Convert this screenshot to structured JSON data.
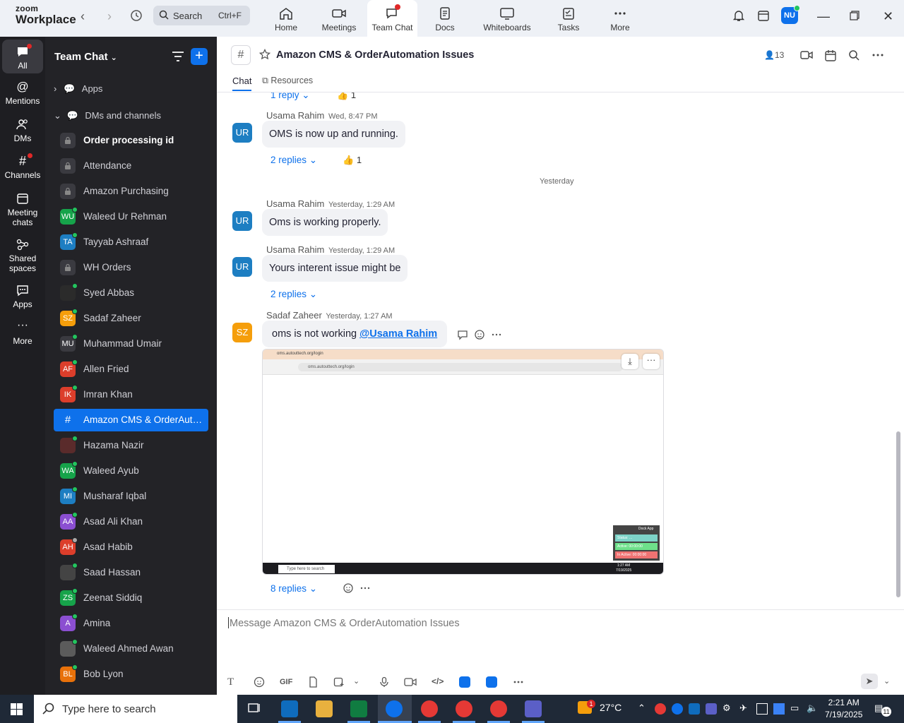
{
  "app": {
    "logo_line1": "zoom",
    "logo_line2": "Workplace",
    "search_label": "Search",
    "search_shortcut": "Ctrl+F",
    "user_initials": "NU"
  },
  "nav_tabs": [
    {
      "label": "Home",
      "icon": "home-icon"
    },
    {
      "label": "Meetings",
      "icon": "camera-icon"
    },
    {
      "label": "Team Chat",
      "icon": "chat-icon",
      "active": true
    },
    {
      "label": "Docs",
      "icon": "doc-icon"
    },
    {
      "label": "Whiteboards",
      "icon": "whiteboard-icon"
    },
    {
      "label": "Tasks",
      "icon": "tasks-icon"
    },
    {
      "label": "More",
      "icon": "more-icon"
    }
  ],
  "rail": [
    {
      "label": "All"
    },
    {
      "label": "Mentions"
    },
    {
      "label": "DMs"
    },
    {
      "label": "Channels"
    },
    {
      "label": "Meeting chats"
    },
    {
      "label": "Shared spaces"
    },
    {
      "label": "Apps"
    },
    {
      "label": "More"
    }
  ],
  "sidebar": {
    "title": "Team Chat",
    "sections": {
      "apps": "Apps",
      "dms": "DMs and channels"
    },
    "items": [
      {
        "label": "Order processing id",
        "avatar": "",
        "color": "#3a3a40",
        "bold": true
      },
      {
        "label": "Attendance",
        "avatar": "",
        "color": "#3a3a40"
      },
      {
        "label": "Amazon Purchasing",
        "avatar": "",
        "color": "#3a3a40"
      },
      {
        "label": "Waleed Ur Rehman",
        "avatar": "WU",
        "color": "#16a34a"
      },
      {
        "label": "Tayyab Ashraaf",
        "avatar": "TA",
        "color": "#1d7ec2"
      },
      {
        "label": "WH Orders",
        "avatar": "",
        "color": "#3a3a40"
      },
      {
        "label": "Syed Abbas",
        "avatar": "",
        "color": "#2b2b2b"
      },
      {
        "label": "Sadaf Zaheer",
        "avatar": "SZ",
        "color": "#f59e0b"
      },
      {
        "label": "Muhammad Umair",
        "avatar": "MU",
        "color": "#3a3a40"
      },
      {
        "label": "Allen Fried",
        "avatar": "AF",
        "color": "#dc3e2b"
      },
      {
        "label": "Imran Khan",
        "avatar": "IK",
        "color": "#dc3e2b"
      },
      {
        "label": "Amazon CMS & OrderAuto...",
        "avatar": "#",
        "color": "#0e71eb",
        "active": true
      },
      {
        "label": "Hazama Nazir",
        "avatar": "",
        "color": "#5a2b2b"
      },
      {
        "label": "Waleed Ayub",
        "avatar": "WA",
        "color": "#16a34a"
      },
      {
        "label": "Musharaf Iqbal",
        "avatar": "MI",
        "color": "#1d7ec2"
      },
      {
        "label": "Asad Ali Khan",
        "avatar": "AA",
        "color": "#8b4fd1"
      },
      {
        "label": "Asad Habib",
        "avatar": "AH",
        "color": "#dc3e2b"
      },
      {
        "label": "Saad Hassan",
        "avatar": "",
        "color": "#444"
      },
      {
        "label": "Zeenat Siddiq",
        "avatar": "ZS",
        "color": "#16a34a"
      },
      {
        "label": "Amina",
        "avatar": "A",
        "color": "#8b4fd1"
      },
      {
        "label": "Waleed Ahmed Awan",
        "avatar": "",
        "color": "#5b5b5b"
      },
      {
        "label": "Bob Lyon",
        "avatar": "BL",
        "color": "#e8710a"
      }
    ]
  },
  "channel": {
    "title": "Amazon CMS & OrderAutomation Issues",
    "member_count": "13",
    "tabs": {
      "chat": "Chat",
      "resources": "Resources"
    }
  },
  "messages": {
    "top_reply": "1 reply",
    "top_react_count": "1",
    "day_separator": "Yesterday",
    "items": [
      {
        "avatar": "UR",
        "sender": "Usama Rahim",
        "time": "Wed, 8:47 PM",
        "text": "OMS is now up and running.",
        "replies": "2 replies",
        "reaction_count": "1"
      },
      {
        "avatar": "UR",
        "sender": "Usama Rahim",
        "time": "Yesterday, 1:29 AM",
        "text": "Oms is working properly."
      },
      {
        "avatar": "UR",
        "sender": "Usama Rahim",
        "time": "Yesterday, 1:29 AM",
        "text": "Yours interent issue might be",
        "replies": "2 replies"
      },
      {
        "avatar": "SZ",
        "sender": "Sadaf Zaheer",
        "time": "Yesterday, 1:27 AM",
        "text": "oms is not working",
        "mention": "@Usama Rahim",
        "replies": "8 replies"
      }
    ],
    "screenshot": {
      "url": "oms.autouttech.org/login",
      "tab": "oms.autouttech.org/login",
      "taskbar_search": "Type here to search",
      "popup_title": "Dock App",
      "popup_rows": [
        {
          "text": "Status: ...",
          "color": "#7dd3c8"
        },
        {
          "text": "Active: 00:00:00",
          "color": "#6ee08a"
        },
        {
          "text": "In Active: 00:00:00",
          "color": "#f07272"
        }
      ],
      "time": "1:27 AM",
      "date": "7/19/2025"
    }
  },
  "composer": {
    "placeholder": "Message Amazon CMS & OrderAutomation Issues",
    "gif_label": "GIF"
  },
  "taskbar": {
    "search": "Type here to search",
    "temperature": "27°C",
    "time": "2:21 AM",
    "date": "7/19/2025",
    "weather_badge": "1",
    "notification_count": "11"
  }
}
